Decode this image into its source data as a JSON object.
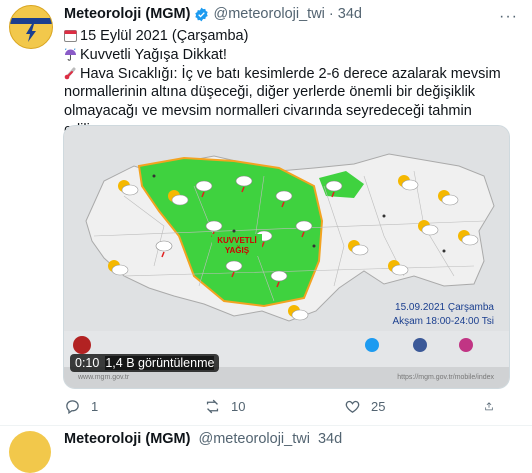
{
  "tweet": {
    "display_name": "Meteoroloji (MGM)",
    "handle": "@meteoroloji_twi",
    "separator": "·",
    "time": "34d",
    "more_label": "···",
    "lines": {
      "date": "15 Eylül 2021 (Çarşamba)",
      "warning": "Kuvvetli Yağışa Dikkat!",
      "temp": "Hava Sıcaklığı: İç ve batı kesimlerde 2-6 derece azalarak mevsim normallerinin altına düşeceği, diğer yerlerde önemli bir değişiklik olmayacağı ve mevsim normalleri civarında seyredeceği tahmin ediliyor."
    },
    "media": {
      "map_label_line1": "KUVVETLİ",
      "map_label_line2": "YAĞIŞ",
      "date_caption": "15.09.2021 Çarşamba",
      "time_caption": "Akşam 18:00-24:00 Tsi",
      "duration": "0:10",
      "views": "1,4 B görüntülenme",
      "footer_left": "www.mgm.gov.tr",
      "footer_right": "https://mgm.gov.tr/mobile/index"
    },
    "actions": {
      "reply_count": "1",
      "retweet_count": "10",
      "like_count": "25"
    },
    "colors": {
      "verified": "#1d9bf0",
      "map_green": "#3fd23f",
      "map_land": "#eaeaea",
      "sea": "#dcdcdc"
    }
  },
  "next_tweet": {
    "display_name": "Meteoroloji (MGM)",
    "handle": "@meteoroloji_twi",
    "time": "34d"
  }
}
